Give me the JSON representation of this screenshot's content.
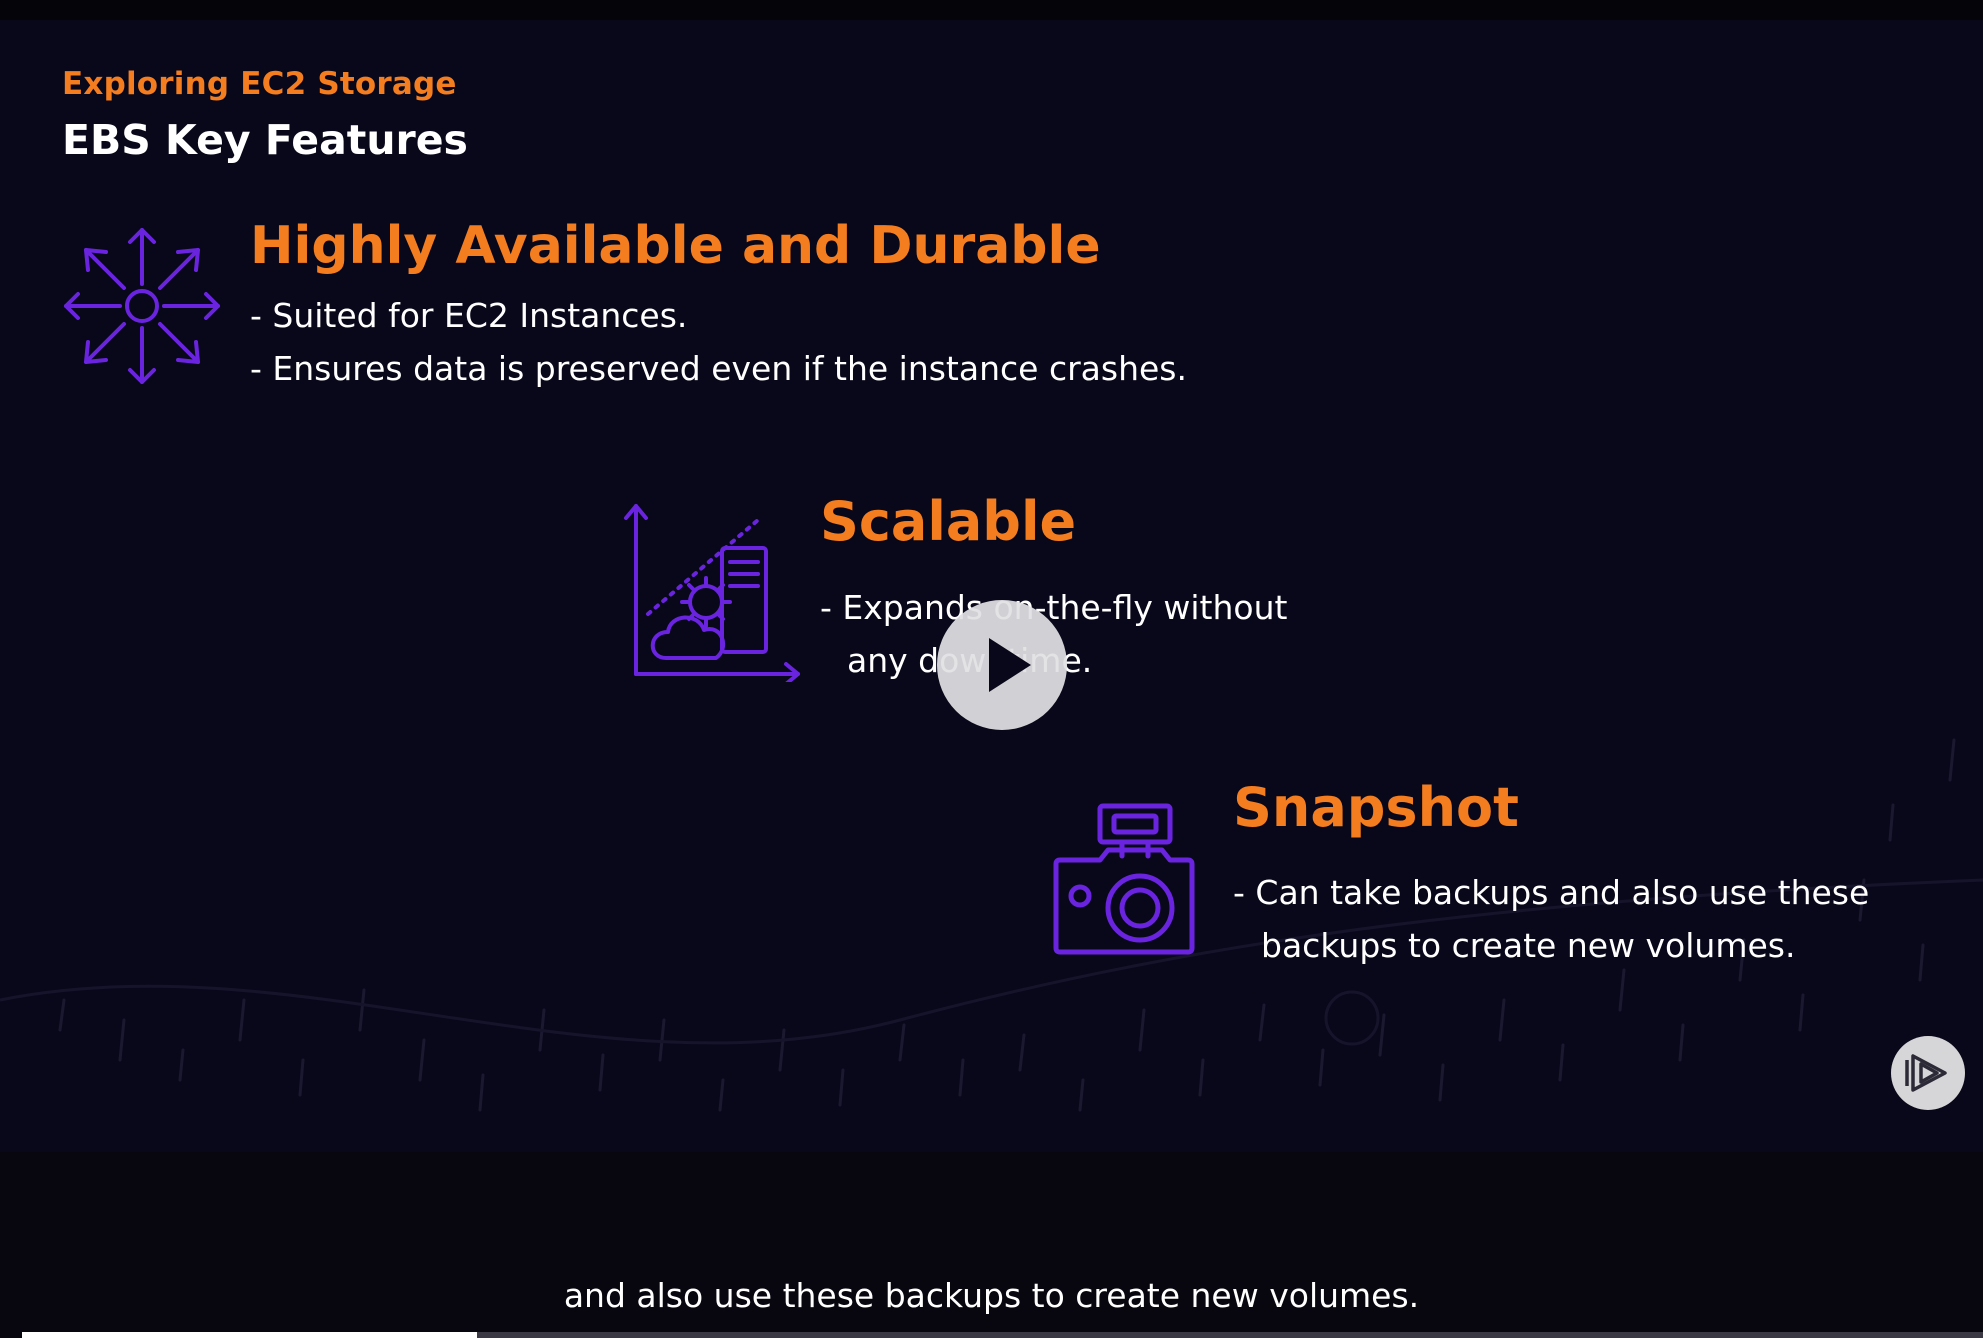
{
  "slide": {
    "kicker": "Exploring EC2 Storage",
    "title": "EBS Key Features",
    "features": [
      {
        "icon": "arrows-outward-icon",
        "heading": "Highly Available and Durable",
        "lines": [
          "- Suited for EC2 Instances.",
          "- Ensures data is preserved even if the instance crashes."
        ]
      },
      {
        "icon": "scaling-chart-icon",
        "heading": "Scalable",
        "lines": [
          "- Expands on-the-fly without",
          "any downtime."
        ]
      },
      {
        "icon": "camera-icon",
        "heading": "Snapshot",
        "lines": [
          "- Can take backups and also use these",
          "backups to create new volumes."
        ]
      }
    ]
  },
  "player": {
    "play_icon": "play-icon",
    "brand_icon": "pluralsight-logo-icon",
    "caption": "and also use these backups to create new volumes.",
    "progress": 0.232
  },
  "colors": {
    "accent_orange": "#f47d20",
    "icon_purple": "#6a24e0",
    "background": "#09081a"
  }
}
